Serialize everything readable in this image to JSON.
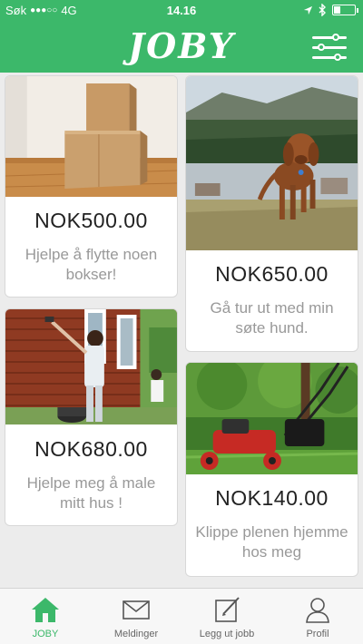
{
  "status": {
    "carrier": "Søk",
    "signal_dots": "●●●○○",
    "network": "4G",
    "time": "14.16",
    "battery_level": 0.3
  },
  "header": {
    "logo": "JOBY",
    "menu_icon": "sliders-icon"
  },
  "jobs": [
    {
      "price": "NOK500.00",
      "description": "Hjelpe å flytte noen bokser!",
      "image": "boxes"
    },
    {
      "price": "NOK650.00",
      "description": "Gå tur ut med min søte hund.",
      "image": "dog"
    },
    {
      "price": "NOK680.00",
      "description": "Hjelpe meg å male mitt hus !",
      "image": "painting"
    },
    {
      "price": "NOK140.00",
      "description": "Klippe plenen hjemme hos meg",
      "image": "lawnmower"
    }
  ],
  "tabs": [
    {
      "label": "JOBY",
      "icon": "home-icon",
      "active": true
    },
    {
      "label": "Meldinger",
      "icon": "envelope-icon",
      "active": false
    },
    {
      "label": "Legg ut jobb",
      "icon": "edit-icon",
      "active": false
    },
    {
      "label": "Profil",
      "icon": "user-icon",
      "active": false
    }
  ],
  "colors": {
    "brand_green": "#3cb86a",
    "description_gray": "#999999"
  }
}
